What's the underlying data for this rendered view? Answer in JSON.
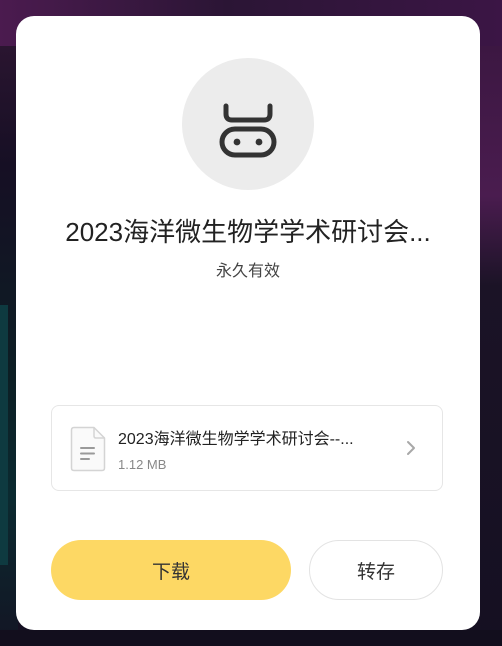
{
  "colors": {
    "primary_button": "#fdd864",
    "avatar_bg": "#ececec",
    "icon_stroke": "#333333"
  },
  "icons": {
    "avatar": "cow-face-icon",
    "file": "document-icon",
    "chevron": "chevron-right-icon"
  },
  "share": {
    "title": "2023海洋微生物学学术研讨会...",
    "validity": "永久有效"
  },
  "file": {
    "name": "2023海洋微生物学学术研讨会--...",
    "size": "1.12 MB"
  },
  "actions": {
    "download_label": "下载",
    "save_label": "转存"
  }
}
